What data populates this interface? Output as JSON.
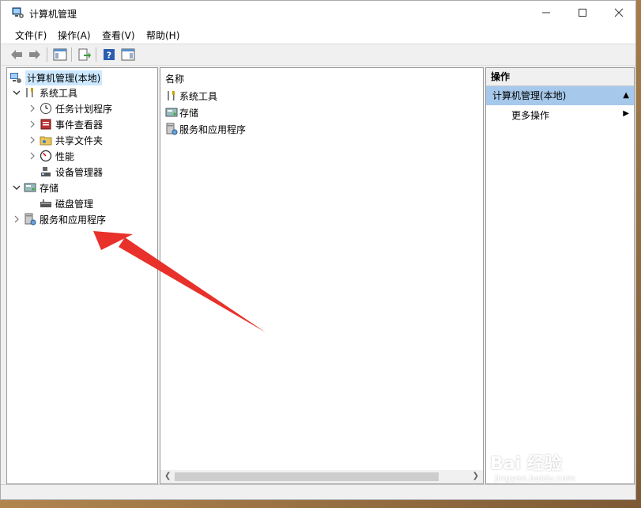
{
  "window": {
    "title": "计算机管理"
  },
  "menu": [
    {
      "label": "文件(F)"
    },
    {
      "label": "操作(A)"
    },
    {
      "label": "查看(V)"
    },
    {
      "label": "帮助(H)"
    }
  ],
  "tree": {
    "root": "计算机管理(本地)",
    "system_tools": "系统工具",
    "task_scheduler": "任务计划程序",
    "event_viewer": "事件查看器",
    "shared_folders": "共享文件夹",
    "performance": "性能",
    "device_manager": "设备管理器",
    "storage": "存储",
    "disk_management": "磁盘管理",
    "services_apps": "服务和应用程序"
  },
  "list": {
    "column_name": "名称",
    "items": [
      "系统工具",
      "存储",
      "服务和应用程序"
    ]
  },
  "actions": {
    "header": "操作",
    "group": "计算机管理(本地)",
    "more": "更多操作"
  },
  "watermark": {
    "text": "Bai 经验",
    "sub": "jingyan.baidu.com"
  },
  "colors": {
    "selection": "#cce8ff",
    "action_group": "#a6c8ea",
    "arrow": "#e8312a"
  }
}
